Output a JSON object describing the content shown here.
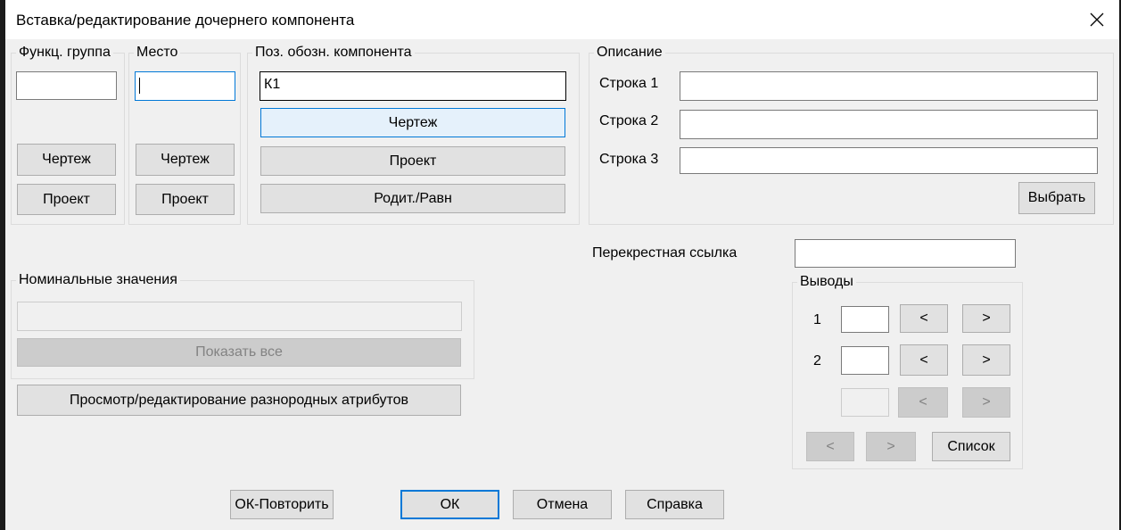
{
  "window": {
    "title": "Вставка/редактирование дочернего компонента"
  },
  "func_group": {
    "label": "Функц. группа",
    "value": "",
    "drawing_btn": "Чертеж",
    "project_btn": "Проект"
  },
  "location": {
    "label": "Место",
    "value": "",
    "drawing_btn": "Чертеж",
    "project_btn": "Проект"
  },
  "tag": {
    "label": "Поз. обозн. компонента",
    "value": "К1",
    "drawing_btn": "Чертеж",
    "project_btn": "Проект",
    "parent_btn": "Родит./Равн"
  },
  "description": {
    "label": "Описание",
    "lines": [
      {
        "label": "Строка 1",
        "value": ""
      },
      {
        "label": "Строка 2",
        "value": ""
      },
      {
        "label": "Строка 3",
        "value": ""
      }
    ],
    "pick_btn": "Выбрать"
  },
  "cross_ref": {
    "label": "Перекрестная ссылка",
    "value": ""
  },
  "ratings": {
    "label": "Номинальные значения",
    "value": "",
    "show_all_btn": "Показать все"
  },
  "attributes_btn": "Просмотр/редактирование разнородных атрибутов",
  "pins": {
    "label": "Выводы",
    "rows": [
      {
        "num": "1",
        "value": "",
        "prev": "<",
        "next": ">"
      },
      {
        "num": "2",
        "value": "",
        "prev": "<",
        "next": ">"
      },
      {
        "num": "",
        "value": "",
        "prev": "<",
        "next": ">"
      }
    ],
    "nav_prev": "<",
    "nav_next": ">",
    "list_btn": "Список"
  },
  "footer": {
    "ok_repeat": "ОК-Повторить",
    "ok": "ОК",
    "cancel": "Отмена",
    "help": "Справка"
  }
}
